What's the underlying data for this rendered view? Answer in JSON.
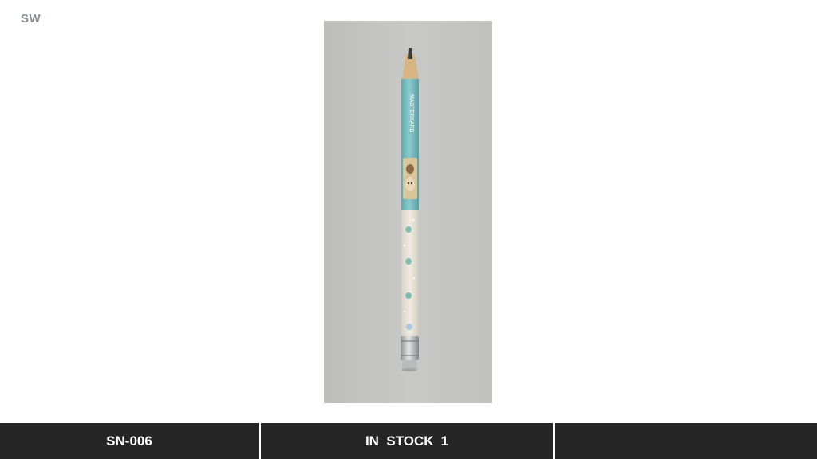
{
  "header": {
    "brand": "SW"
  },
  "product": {
    "image": "pencil-photo",
    "code": "SN-006",
    "stock_label": "IN  STOCK",
    "stock_count": "1",
    "extra": ""
  },
  "colors": {
    "brand_text": "#8a9099",
    "bar_background": "#262626",
    "photo_background": "#c4c4c2",
    "pencil_teal": "#7fc0c4",
    "pencil_cream": "#ece6da",
    "dot_teal": "#7fbeb4"
  }
}
